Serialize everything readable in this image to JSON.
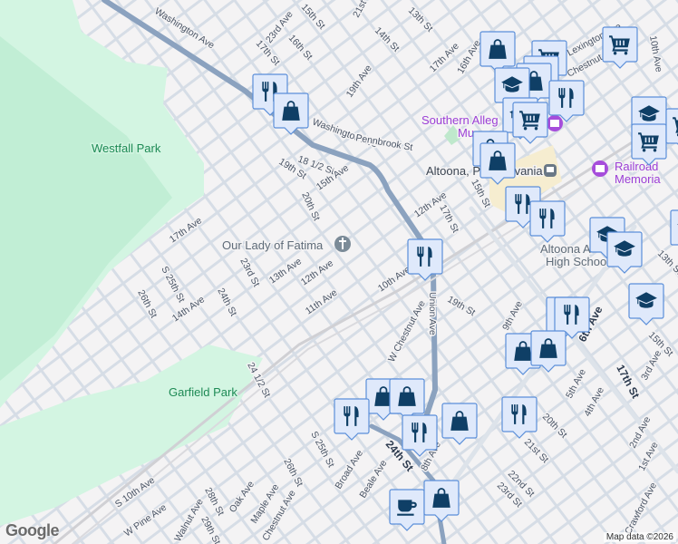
{
  "map": {
    "parks": {
      "westfall": "Westfall Park",
      "garfield": "Garfield Park"
    },
    "pois": {
      "church": "Our Lady of Fatima",
      "museum": "Southern Alleg",
      "museum2": "Mu",
      "city": "Altoona, Pennsylvania",
      "railroad": "Railroad",
      "railroad2": "Memoria",
      "school": "Altoona A",
      "school2": "High School"
    },
    "streets": [
      "Washington Ave",
      "23rd Ave",
      "15th St",
      "17th St",
      "16th St",
      "Washington Ave",
      "18 1/2 St",
      "19th St",
      "15th Ave",
      "20th St",
      "17th Ave",
      "S 25th St",
      "23rd St",
      "13th Ave",
      "12th Ave",
      "26th St",
      "14th Ave",
      "24th St",
      "11th Ave",
      "10th Ave",
      "24 1/2 St",
      "S 10th Ave",
      "W Pine Ave",
      "28th St",
      "29th St",
      "Oak Ave",
      "Maple Ave",
      "26th St",
      "S 25th St",
      "Chestnut Ave",
      "Walnut Ave",
      "Broad Ave",
      "Beale Ave",
      "24th St",
      "8th Ave",
      "Union Ave",
      "W Chestnut Ave",
      "19th St",
      "9th Ave",
      "6th Ave",
      "17th St",
      "5th Ave",
      "4th Ave",
      "3rd Ave",
      "2nd Ave",
      "1st Ave",
      "20th St",
      "21st St",
      "22nd St",
      "23rd St",
      "15th St",
      "13th St",
      "Crawford Ave",
      "13th St",
      "14th St",
      "21st",
      "17th Ave",
      "19th Ave",
      "16th Ave",
      "Pennbrook St",
      "12th Ave",
      "17th St",
      "15th St",
      "Chestnut Ave",
      "Lexington Ave",
      "10th Ave"
    ],
    "markers": [
      "restaurant",
      "shopping",
      "shopping",
      "grocery",
      "restaurant",
      "shopping",
      "education",
      "restaurant",
      "education",
      "grocery",
      "shopping",
      "shopping",
      "grocery",
      "education",
      "grocery",
      "restaurant",
      "restaurant",
      "education",
      "education",
      "education",
      "restaurant",
      "restaurant",
      "restaurant",
      "shopping",
      "shopping",
      "shopping",
      "shopping",
      "restaurant",
      "restaurant",
      "shopping",
      "restaurant",
      "coffee",
      "shopping",
      "grocery",
      "education"
    ],
    "attribution": "Map data ©2026",
    "logo": "Google"
  },
  "colors": {
    "marker_fill": "#dfe9fb",
    "marker_border": "#5b8fd9",
    "marker_icon": "#0f3f66",
    "highway": "#8ba2bf",
    "street": "#d3dbe4"
  }
}
